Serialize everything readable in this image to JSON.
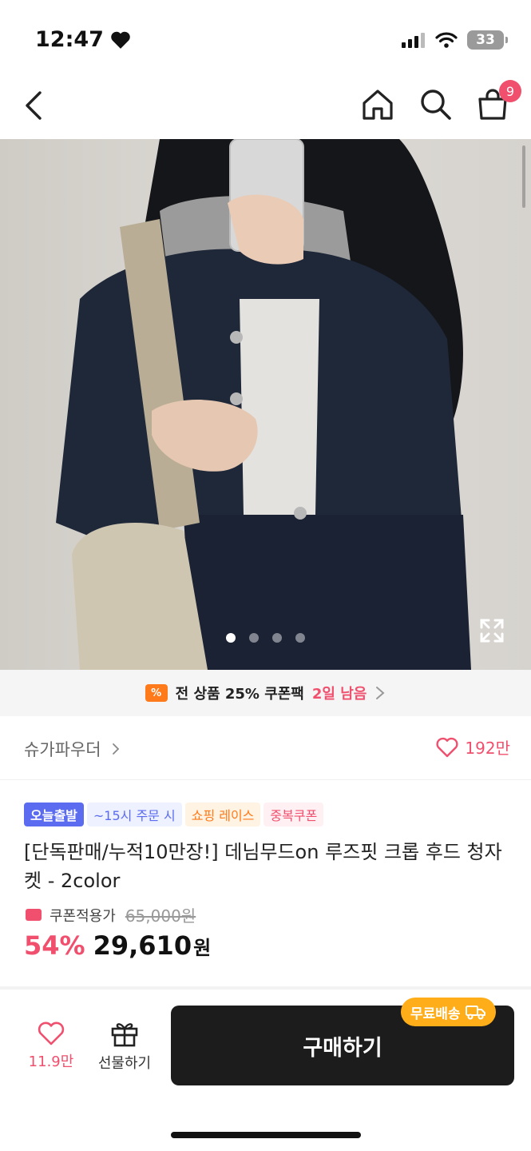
{
  "status_bar": {
    "time": "12:47",
    "battery": "33"
  },
  "nav": {
    "cart_count": "9"
  },
  "hero": {
    "slide_count": 4,
    "active_slide": 0
  },
  "promo": {
    "icon_text": "%",
    "text": "전 상품 25% 쿠폰팩",
    "days_left": "2일 남음"
  },
  "brand": {
    "name": "슈가파우더",
    "likes": "192만"
  },
  "product": {
    "tags": [
      "오늘출발",
      "~15시 주문 시",
      "쇼핑 레이스",
      "중복쿠폰"
    ],
    "title": "[단독판매/누적10만장!] 데님무드on 루즈핏 크롭 후드 청자켓 - 2color",
    "coupon_label": "쿠폰적용가",
    "original_price": "65,000원",
    "discount": "54%",
    "price": "29,610",
    "currency": "원"
  },
  "bottom": {
    "wish_count": "11.9만",
    "gift_label": "선물하기",
    "buy_label": "구매하기",
    "free_shipping": "무료배송"
  },
  "colors": {
    "accent": "#f0506e",
    "tag_blue": "#5b6cf0",
    "orange": "#ff7a1a",
    "shipping": "#ffae1a",
    "buy_button": "#1c1c1c"
  }
}
